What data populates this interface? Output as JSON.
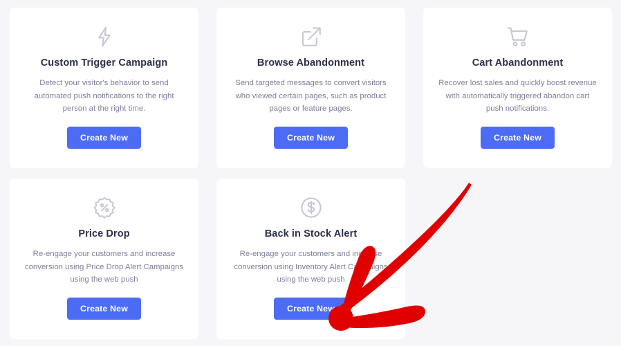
{
  "page": {
    "background_color": "#f6f6f9",
    "card_background": "#ffffff",
    "accent_color": "#4c6cf5",
    "title_color": "#2c3049",
    "description_color": "#7e8198",
    "icon_color": "#c6c8d6",
    "annotation_color": "#e00000"
  },
  "cards": [
    {
      "icon": "lightning-bolt-icon",
      "title": "Custom Trigger Campaign",
      "description": "Detect your visitor's behavior to send automated push notifications to the right person at the right time.",
      "button_label": "Create New"
    },
    {
      "icon": "external-link-icon",
      "title": "Browse Abandonment",
      "description": "Send targeted messages to convert visitors who viewed certain pages, such as product pages or feature pages.",
      "button_label": "Create New"
    },
    {
      "icon": "shopping-cart-icon",
      "title": "Cart Abandonment",
      "description": "Recover lost sales and quickly boost revenue with automatically triggered abandon cart push notifications.",
      "button_label": "Create New"
    },
    {
      "icon": "percent-badge-icon",
      "title": "Price Drop",
      "description": "Re-engage your customers and increase conversion using Price Drop Alert Campaigns using the web push",
      "button_label": "Create New"
    },
    {
      "icon": "dollar-circle-icon",
      "title": "Back in Stock Alert",
      "description": "Re-engage your customers and increase conversion using Inventory Alert Campaigns using the web push",
      "button_label": "Create New"
    }
  ],
  "annotation": {
    "name": "red-arrow-annotation",
    "points_to": "Back in Stock Alert Create New"
  }
}
